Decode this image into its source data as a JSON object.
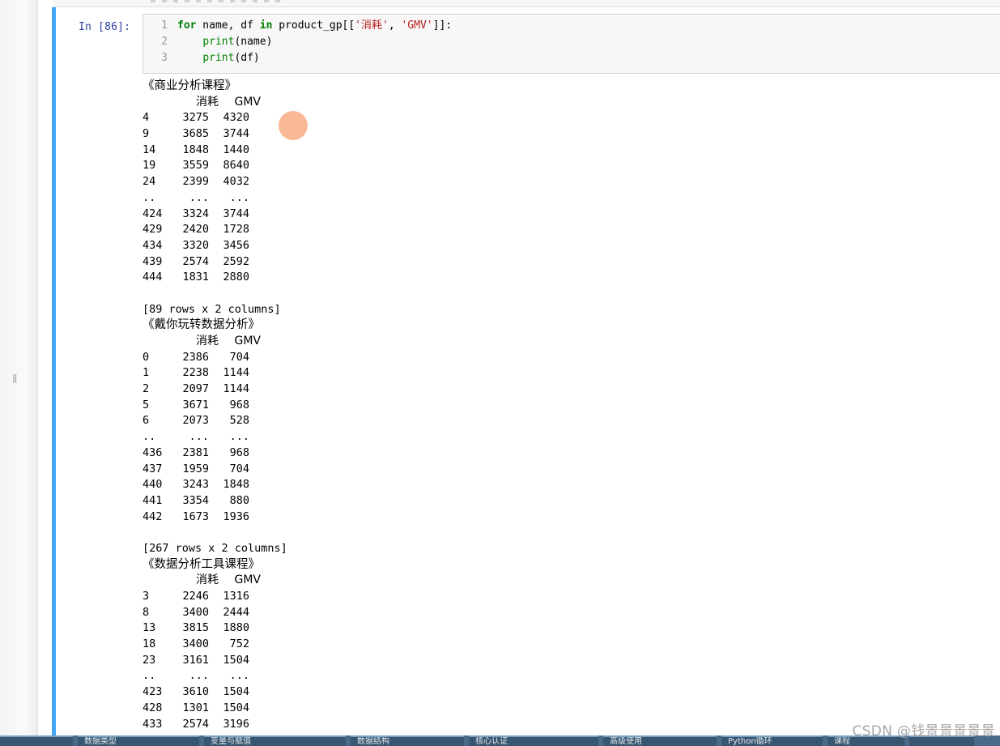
{
  "cell": {
    "prompt": "In  [86]:",
    "code": [
      {
        "no": "1",
        "parts": [
          {
            "t": "for",
            "c": "kw"
          },
          {
            "t": " name, df ",
            "c": ""
          },
          {
            "t": "in",
            "c": "kw"
          },
          {
            "t": " product_gp[[",
            "c": ""
          },
          {
            "t": "'消耗'",
            "c": "str"
          },
          {
            "t": ", ",
            "c": ""
          },
          {
            "t": "'GMV'",
            "c": "str"
          },
          {
            "t": "]]:",
            "c": ""
          }
        ]
      },
      {
        "no": "2",
        "parts": [
          {
            "t": "    ",
            "c": ""
          },
          {
            "t": "print",
            "c": "fn"
          },
          {
            "t": "(name)",
            "c": ""
          }
        ]
      },
      {
        "no": "3",
        "parts": [
          {
            "t": "    ",
            "c": ""
          },
          {
            "t": "print",
            "c": "fn"
          },
          {
            "t": "(df)",
            "c": ""
          }
        ]
      }
    ]
  },
  "output": {
    "groups": [
      {
        "title": "《商业分析课程》",
        "columns": [
          "消耗",
          "GMV"
        ],
        "rows": [
          [
            "4",
            "3275",
            "4320"
          ],
          [
            "9",
            "3685",
            "3744"
          ],
          [
            "14",
            "1848",
            "1440"
          ],
          [
            "19",
            "3559",
            "8640"
          ],
          [
            "24",
            "2399",
            "4032"
          ],
          [
            "..",
            "...",
            "..."
          ],
          [
            "424",
            "3324",
            "3744"
          ],
          [
            "429",
            "2420",
            "1728"
          ],
          [
            "434",
            "3320",
            "3456"
          ],
          [
            "439",
            "2574",
            "2592"
          ],
          [
            "444",
            "1831",
            "2880"
          ]
        ],
        "footer": "[89 rows x 2 columns]"
      },
      {
        "title": "《戴你玩转数据分析》",
        "columns": [
          "消耗",
          "GMV"
        ],
        "rows": [
          [
            "0",
            "2386",
            "704"
          ],
          [
            "1",
            "2238",
            "1144"
          ],
          [
            "2",
            "2097",
            "1144"
          ],
          [
            "5",
            "3671",
            "968"
          ],
          [
            "6",
            "2073",
            "528"
          ],
          [
            "..",
            "...",
            "..."
          ],
          [
            "436",
            "2381",
            "968"
          ],
          [
            "437",
            "1959",
            "704"
          ],
          [
            "440",
            "3243",
            "1848"
          ],
          [
            "441",
            "3354",
            "880"
          ],
          [
            "442",
            "1673",
            "1936"
          ]
        ],
        "footer": "[267 rows x 2 columns]"
      },
      {
        "title": "《数据分析工具课程》",
        "columns": [
          "消耗",
          "GMV"
        ],
        "rows": [
          [
            "3",
            "2246",
            "1316"
          ],
          [
            "8",
            "3400",
            "2444"
          ],
          [
            "13",
            "3815",
            "1880"
          ],
          [
            "18",
            "3400",
            "752"
          ],
          [
            "23",
            "3161",
            "1504"
          ],
          [
            "..",
            "...",
            "..."
          ],
          [
            "423",
            "3610",
            "1504"
          ],
          [
            "428",
            "1301",
            "1504"
          ],
          [
            "433",
            "2574",
            "3196"
          ]
        ],
        "footer": ""
      }
    ]
  },
  "watermark": "CSDN @钱景景景景景",
  "taskbar": {
    "tabs": [
      "",
      "数据类型",
      "变量与赋值",
      "数据结构",
      "核心认证",
      "高级使用",
      "Python循环",
      "课程",
      ""
    ]
  },
  "accent_color": "#42a5f5"
}
